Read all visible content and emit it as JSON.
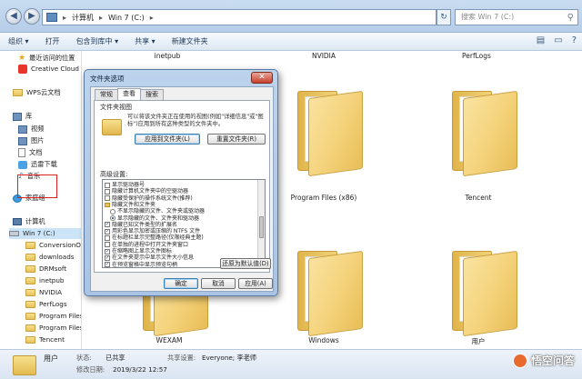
{
  "window": {
    "path": [
      "计算机",
      "Win 7 (C:)"
    ],
    "search_placeholder": "搜索 Win 7 (C:)"
  },
  "toolbar": {
    "items": [
      "组织 ▾",
      "打开",
      "包含到库中 ▾",
      "共享 ▾",
      "新建文件夹"
    ]
  },
  "sidebar": {
    "items": [
      {
        "label": "最近访问的位置",
        "icon": "star-icon"
      },
      {
        "label": "Creative Cloud Fi",
        "icon": "creative-cloud-icon"
      },
      {
        "label": "WPS云文档",
        "icon": "folder-icon"
      },
      {
        "label": "库",
        "icon": "library-icon"
      },
      {
        "label": "视频",
        "icon": "library-icon"
      },
      {
        "label": "图片",
        "icon": "library-icon"
      },
      {
        "label": "文档",
        "icon": "document-icon"
      },
      {
        "label": "迅雷下载",
        "icon": "xunlei-icon"
      },
      {
        "label": "音乐",
        "icon": "music-icon"
      },
      {
        "label": "家庭组",
        "icon": "homegroup-icon"
      },
      {
        "label": "计算机",
        "icon": "computer-icon"
      },
      {
        "label": "Win 7 (C:)",
        "icon": "drive-icon"
      },
      {
        "label": "ConversionOut",
        "icon": "folder-icon"
      },
      {
        "label": "downloads",
        "icon": "folder-icon"
      },
      {
        "label": "DRMsoft",
        "icon": "folder-icon"
      },
      {
        "label": "inetpub",
        "icon": "folder-icon"
      },
      {
        "label": "NVIDIA",
        "icon": "folder-icon"
      },
      {
        "label": "PerfLogs",
        "icon": "folder-icon"
      },
      {
        "label": "Program Files",
        "icon": "folder-icon"
      },
      {
        "label": "Program Files",
        "icon": "folder-icon"
      },
      {
        "label": "Tencent",
        "icon": "folder-icon"
      }
    ]
  },
  "content": {
    "top_labels": [
      "inetpub",
      "NVIDIA",
      "PerfLogs"
    ],
    "folders": [
      "Program Files (x86)",
      "Tencent",
      "WEXAM",
      "Windows",
      "用户"
    ]
  },
  "status": {
    "name": "用户",
    "state_label": "状态:",
    "state_value": "已共享",
    "modified_label": "修改日期:",
    "modified_value": "2019/3/22 12:57",
    "share_label": "共享设置:",
    "share_value": "Everyone; 李老师",
    "watermark": "悟空问答"
  },
  "dialog": {
    "title": "文件夹选项",
    "close": "✕",
    "tabs": [
      "常规",
      "查看",
      "搜索"
    ],
    "folder_view_title": "文件夹视图",
    "folder_view_desc": "可以将该文件夹正在使用的视图(例如\"详细信息\"或\"图标\")应用到所有这种类型的文件夹中。",
    "apply_btn": "应用到文件夹(L)",
    "reset_btn": "重置文件夹(R)",
    "advanced_title": "高级设置:",
    "advanced_rows": [
      {
        "type": "checkbox",
        "checked": false,
        "indent": 0,
        "label": "显示驱动器号"
      },
      {
        "type": "checkbox",
        "checked": false,
        "indent": 0,
        "label": "隐藏计算机文件夹中的空驱动器"
      },
      {
        "type": "checkbox",
        "checked": false,
        "indent": 0,
        "label": "隐藏受保护的操作系统文件(推荐)"
      },
      {
        "type": "folder",
        "checked": false,
        "indent": 0,
        "label": "隐藏文件和文件夹"
      },
      {
        "type": "radio",
        "checked": false,
        "indent": 1,
        "label": "不显示隐藏的文件、文件夹或驱动器"
      },
      {
        "type": "radio",
        "checked": true,
        "indent": 1,
        "label": "显示隐藏的文件、文件夹和驱动器"
      },
      {
        "type": "checkbox",
        "checked": true,
        "indent": 0,
        "label": "隐藏已知文件类型的扩展名"
      },
      {
        "type": "checkbox",
        "checked": true,
        "indent": 0,
        "label": "用彩色显示加密或压缩的 NTFS 文件"
      },
      {
        "type": "checkbox",
        "checked": false,
        "indent": 0,
        "label": "在标题栏显示完整路径(仅限经典主题)"
      },
      {
        "type": "checkbox",
        "checked": false,
        "indent": 0,
        "label": "在单独的进程中打开文件夹窗口"
      },
      {
        "type": "checkbox",
        "checked": true,
        "indent": 0,
        "label": "在缩略图上显示文件图标"
      },
      {
        "type": "checkbox",
        "checked": true,
        "indent": 0,
        "label": "在文件夹提示中显示文件大小信息"
      },
      {
        "type": "checkbox",
        "checked": true,
        "indent": 0,
        "label": "在预览窗格中显示预览句柄"
      }
    ],
    "restore_btn": "还原为默认值(D)",
    "ok_btn": "确定",
    "cancel_btn": "取消",
    "apply_footer_btn": "应用(A)"
  }
}
